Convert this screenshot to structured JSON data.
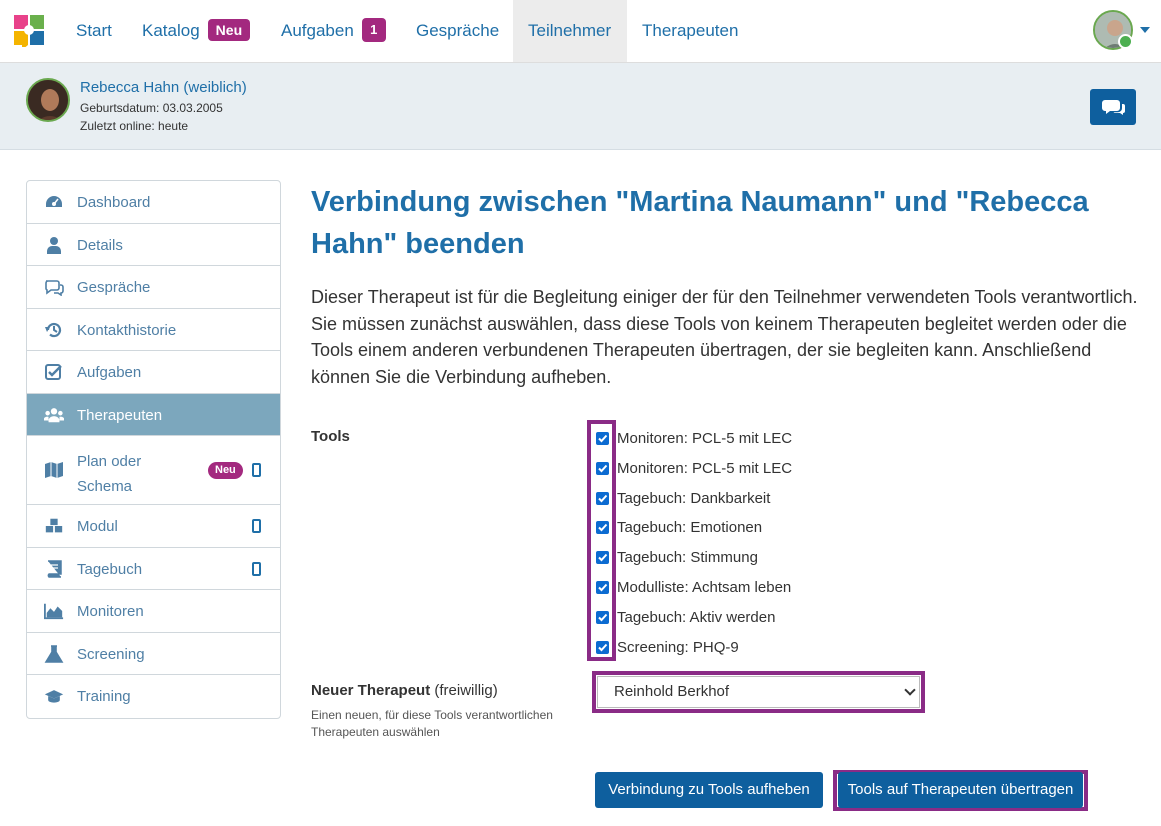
{
  "nav": {
    "items": [
      {
        "label": "Start"
      },
      {
        "label": "Katalog",
        "badge": "Neu"
      },
      {
        "label": "Aufgaben",
        "count": "1"
      },
      {
        "label": "Gespräche"
      },
      {
        "label": "Teilnehmer",
        "active": true
      },
      {
        "label": "Therapeuten"
      }
    ]
  },
  "patient": {
    "name": "Rebecca Hahn (weiblich)",
    "birthdate": "Geburtsdatum: 03.03.2005",
    "last_online": "Zuletzt online: heute"
  },
  "sidebar": {
    "items": [
      {
        "label": "Dashboard",
        "icon": "dashboard-icon"
      },
      {
        "label": "Details",
        "icon": "user-icon"
      },
      {
        "label": "Gespräche",
        "icon": "comments-icon"
      },
      {
        "label": "Kontakthistorie",
        "icon": "history-icon"
      },
      {
        "label": "Aufgaben",
        "icon": "check-square-icon"
      },
      {
        "label": "Therapeuten",
        "icon": "users-icon",
        "active": true
      },
      {
        "label": "Plan oder Schema",
        "icon": "map-icon",
        "badge": "Neu",
        "mobile": true
      },
      {
        "label": "Modul",
        "icon": "cubes-icon",
        "mobile": true
      },
      {
        "label": "Tagebuch",
        "icon": "book-icon",
        "mobile": true
      },
      {
        "label": "Monitoren",
        "icon": "area-chart-icon"
      },
      {
        "label": "Screening",
        "icon": "flask-icon"
      },
      {
        "label": "Training",
        "icon": "graduation-cap-icon"
      }
    ]
  },
  "main": {
    "title": "Verbindung zwischen \"Martina Naumann\" und \"Rebecca Hahn\" beenden",
    "description": "Dieser Therapeut ist für die Begleitung einiger der für den Teilnehmer verwendeten Tools verantwortlich. Sie müssen zunächst auswählen, dass diese Tools von keinem Therapeuten begleitet werden oder die Tools einem anderen verbundenen Therapeuten übertragen, der sie begleiten kann. Anschließend können Sie die Verbindung aufheben.",
    "tools_label": "Tools",
    "tools": [
      {
        "label": "Monitoren: PCL-5 mit LEC",
        "checked": true
      },
      {
        "label": "Monitoren: PCL-5 mit LEC",
        "checked": true
      },
      {
        "label": "Tagebuch: Dankbarkeit",
        "checked": true
      },
      {
        "label": "Tagebuch: Emotionen",
        "checked": true
      },
      {
        "label": "Tagebuch: Stimmung",
        "checked": true
      },
      {
        "label": "Modulliste: Achtsam leben",
        "checked": true
      },
      {
        "label": "Tagebuch: Aktiv werden",
        "checked": true
      },
      {
        "label": "Screening: PHQ-9",
        "checked": true
      }
    ],
    "new_therapist_label": "Neuer Therapeut",
    "new_therapist_optional": "(freiwillig)",
    "new_therapist_help": "Einen neuen, für diese Tools verantwortlichen Therapeuten auswählen",
    "new_therapist_selected": "Reinhold Berkhof",
    "btn_remove": "Verbindung zu Tools aufheben",
    "btn_transfer": "Tools auf Therapeuten übertragen"
  },
  "colors": {
    "brand_blue": "#1f6fa8",
    "button_blue": "#0e5f9e",
    "highlight_purple": "#8a2b86",
    "badge_magenta": "#a3297f",
    "sidebar_active": "#7ca7bd"
  }
}
